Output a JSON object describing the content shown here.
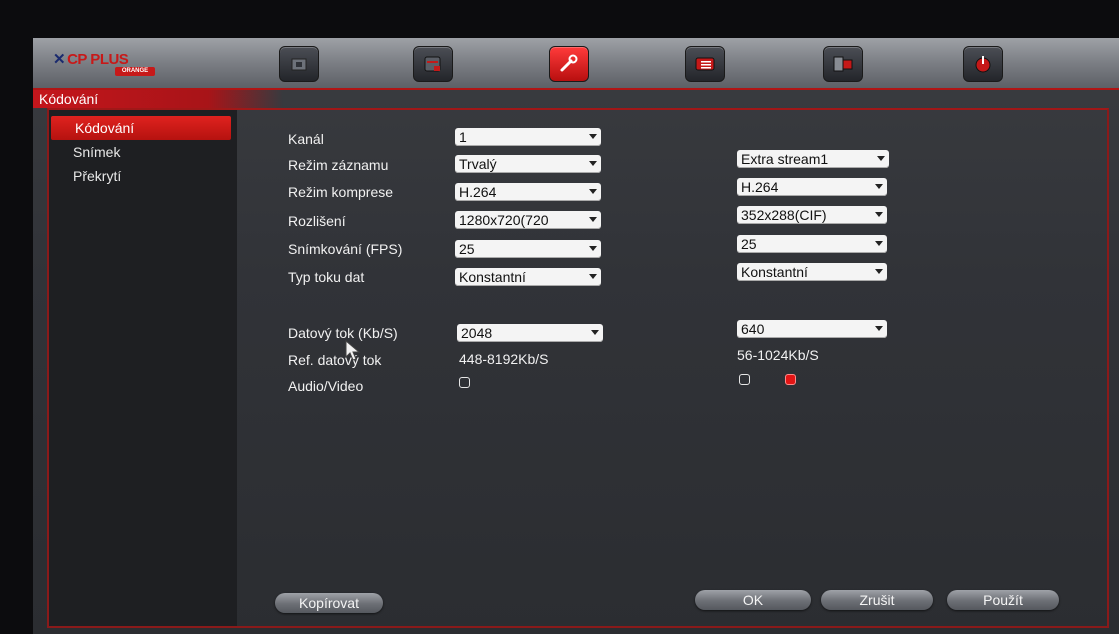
{
  "brand": {
    "name": "CP PLUS",
    "mark": "✕",
    "sub": "ORANGE"
  },
  "header": {
    "title": "Kódování"
  },
  "nav": [
    {
      "name": "camera-icon"
    },
    {
      "name": "storage-icon"
    },
    {
      "name": "settings-wrench-icon",
      "active": true
    },
    {
      "name": "info-icon"
    },
    {
      "name": "advanced-icon"
    },
    {
      "name": "power-icon"
    }
  ],
  "sidebar": {
    "items": [
      {
        "label": "Kódování",
        "active": true
      },
      {
        "label": "Snímek"
      },
      {
        "label": "Překrytí"
      }
    ]
  },
  "form": {
    "channel": {
      "label": "Kanál",
      "main": "1"
    },
    "record_mode": {
      "label": "Režim záznamu",
      "main": "Trvalý",
      "extra": "Extra stream1"
    },
    "compression": {
      "label": "Režim komprese",
      "main": "H.264",
      "extra": "H.264"
    },
    "resolution": {
      "label": "Rozlišení",
      "main": "1280x720(720",
      "extra": "352x288(CIF)"
    },
    "fps": {
      "label": "Snímkování (FPS)",
      "main": "25",
      "extra": "25"
    },
    "bitrate_type": {
      "label": "Typ toku dat",
      "main": "Konstantní",
      "extra": "Konstantní"
    },
    "bitrate": {
      "label": "Datový tok (Kb/S)",
      "main": "2048",
      "extra": "640"
    },
    "ref_bitrate": {
      "label": "Ref. datový tok",
      "main": "448-8192Kb/S",
      "extra": "56-1024Kb/S"
    },
    "audio_video": {
      "label": "Audio/Video"
    }
  },
  "buttons": {
    "copy": "Kopírovat",
    "ok": "OK",
    "cancel": "Zrušit",
    "apply": "Použít"
  },
  "colors": {
    "accent": "#c4161c",
    "active_red": "#e31515"
  }
}
